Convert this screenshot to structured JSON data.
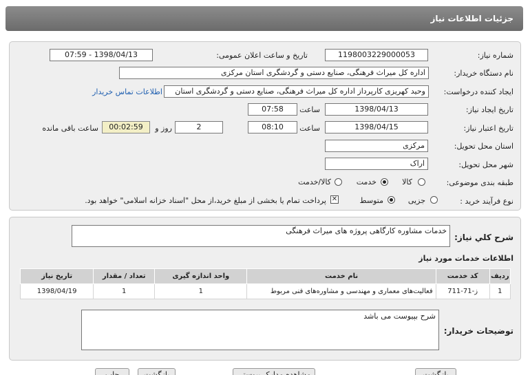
{
  "page_title": "جزئیات اطلاعات نیاز",
  "fields": {
    "need_number_label": "شماره نیاز:",
    "need_number": "1198003229000053",
    "announce_label": "تاریخ و ساعت اعلان عمومی:",
    "announce_value": "1398/04/13 - 07:59",
    "buyer_label": "نام دستگاه خریدار:",
    "buyer_value": "اداره کل میراث فرهنگی، صنایع دستی و گردشگری استان مرکزی",
    "requester_label": "ایجاد کننده درخواست:",
    "requester_value": "وحید کهریزی کارپرداز اداره کل میراث فرهنگی، صنایع دستی و گردشگری استان",
    "contact_link": "اطلاعات تماس خریدار",
    "create_date_label": "تاریخ ایجاد نیاز:",
    "create_date": "1398/04/13",
    "create_time_label": "ساعت",
    "create_time": "07:58",
    "validity_label": "تاریخ اعتبار نیاز:",
    "validity_date": "1398/04/15",
    "validity_time_label": "ساعت",
    "validity_time": "08:10",
    "days_value": "2",
    "days_label": "روز و",
    "remaining_time": "00:02:59",
    "remaining_label": "ساعت باقی مانده",
    "province_label": "استان محل تحویل:",
    "province_value": "مرکزی",
    "city_label": "شهر محل تحویل:",
    "city_value": "اراک",
    "category_label": "طبقه بندی موضوعی:",
    "category_options": [
      "کالا",
      "خدمت",
      "کالا/خدمت"
    ],
    "category_selected": "خدمت",
    "process_label": "نوع فرآیند خرید :",
    "process_options": [
      "جزیی",
      "متوسط"
    ],
    "process_selected": "متوسط",
    "payment_note": "پرداخت تمام یا بخشی از مبلغ خرید،از محل \"اسناد خزانه اسلامی\" خواهد بود."
  },
  "summary": {
    "label": "شرح کلي نیاز:",
    "value": "خدمات مشاوره کارگاهی پروژه های میراث فرهنگی"
  },
  "services": {
    "section_title": "اطلاعات خدمات مورد نیاز",
    "headers": [
      "ردیف",
      "کد خدمت",
      "نام خدمت",
      "واحد اندازه گیری",
      "تعداد / مقدار",
      "تاریخ نیاز"
    ],
    "rows": [
      [
        "1",
        "ز-71-711",
        "فعالیت‌های معماری و مهندسی و مشاوره‌های فنی مربوط",
        "1",
        "1",
        "1398/04/19"
      ]
    ]
  },
  "buyer_notes": {
    "label": "توضیحات خریدار:",
    "value": "شرح بپیوست می باشد"
  },
  "footer_buttons": [
    "بازگشت",
    "مشاهده مدارک پیوستی (1)",
    "بازگشت",
    "چاپ"
  ]
}
